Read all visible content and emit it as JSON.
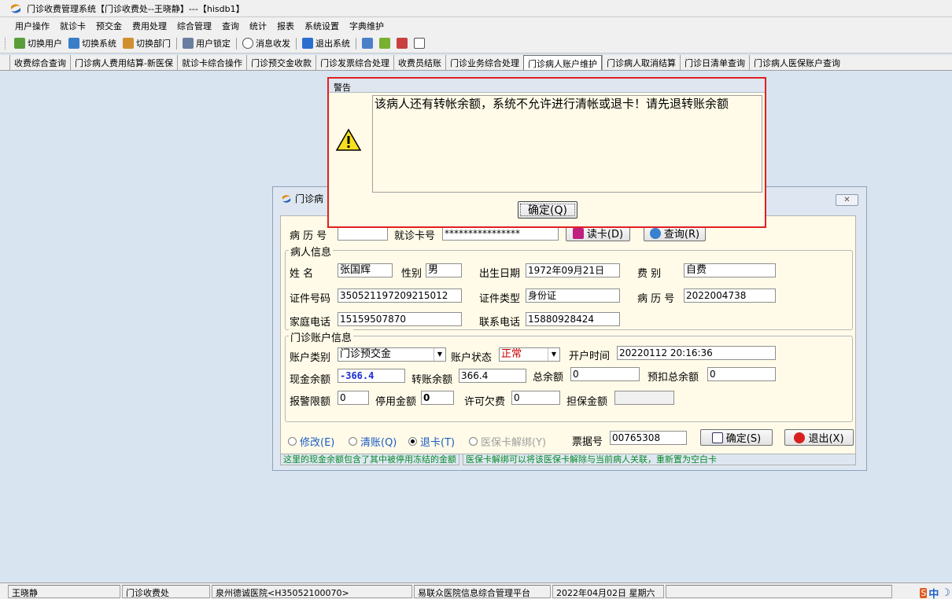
{
  "window": {
    "title": "门诊收费管理系统【门诊收费处--王晓静】---【hisdb1】"
  },
  "menu": [
    "用户操作",
    "就诊卡",
    "预交金",
    "费用处理",
    "综合管理",
    "查询",
    "统计",
    "报表",
    "系统设置",
    "字典维护"
  ],
  "toolbar": {
    "switch_user": "切换用户",
    "switch_system": "切换系统",
    "switch_dept": "切换部门",
    "lock_user": "用户锁定",
    "messages": "消息收发",
    "exit_system": "退出系统"
  },
  "tabs": [
    {
      "label": "收费综合查询",
      "active": false
    },
    {
      "label": "门诊病人费用结算-新医保",
      "active": false
    },
    {
      "label": "就诊卡综合操作",
      "active": false
    },
    {
      "label": "门诊预交金收款",
      "active": false
    },
    {
      "label": "门诊发票综合处理",
      "active": false
    },
    {
      "label": "收费员结账",
      "active": false
    },
    {
      "label": "门诊业务综合处理",
      "active": false
    },
    {
      "label": "门诊病人账户维护",
      "active": true
    },
    {
      "label": "门诊病人取消结算",
      "active": false
    },
    {
      "label": "门诊日清单查询",
      "active": false
    },
    {
      "label": "门诊病人医保账户查询",
      "active": false
    }
  ],
  "account_dialog": {
    "title": "门诊病",
    "record_no_label": "病 历 号",
    "record_no_value": "",
    "card_no_label": "就诊卡号",
    "card_no_value": "****************",
    "read_card_btn": "读卡(D)",
    "query_btn": "查询(R)",
    "patient_group": "病人信息",
    "name_label": "姓    名",
    "name_value": "张国辉",
    "gender_label": "性别",
    "gender_value": "男",
    "birth_label": "出生日期",
    "birth_value": "1972年09月21日",
    "fee_label": "费    别",
    "fee_value": "自费",
    "id_no_label": "证件号码",
    "id_no_value": "350521197209215012",
    "id_type_label": "证件类型",
    "id_type_value": "身份证",
    "record_no2_label": "病 历 号",
    "record_no2_value": "2022004738",
    "home_phone_label": "家庭电话",
    "home_phone_value": "15159507870",
    "contact_phone_label": "联系电话",
    "contact_phone_value": "15880928424",
    "account_group": "门诊账户信息",
    "acct_type_label": "账户类别",
    "acct_type_value": "门诊预交金",
    "acct_status_label": "账户状态",
    "acct_status_value": "正常",
    "open_time_label": "开户时间",
    "open_time_value": "20220112 20:16:36",
    "cash_balance_label": "现金余额",
    "cash_balance_value": "-366.4",
    "transfer_balance_label": "转账余额",
    "transfer_balance_value": "366.4",
    "total_balance_label": "总余额",
    "total_balance_value": "0",
    "prededuct_label": "预扣总余额",
    "prededuct_value": "0",
    "alarm_limit_label": "报警限额",
    "alarm_limit_value": "0",
    "stop_amount_label": "停用金额",
    "stop_amount_value": "0",
    "overdraft_label": "许可欠费",
    "overdraft_value": "0",
    "guarantee_label": "担保金额",
    "guarantee_value": "",
    "radio_modify": "修改(E)",
    "radio_clear": "清账(Q)",
    "radio_refund": "退卡(T)",
    "radio_unbind": "医保卡解绑(Y)",
    "receipt_label": "票据号",
    "receipt_value": "00765308",
    "confirm_btn": "确定(S)",
    "exit_btn": "退出(X)",
    "hint1": "这里的现金余额包含了其中被停用冻结的金额",
    "hint2": "医保卡解绑可以将该医保卡解除与当前病人关联，重新置为空白卡"
  },
  "warning": {
    "title": "警告",
    "message": "该病人还有转帐余额，系统不允许进行清帐或退卡！请先退转账余额",
    "ok": "确定(Q)"
  },
  "status": {
    "user": "王晓静",
    "dept": "门诊收费处",
    "hospital": "泉州德诚医院<H35052100070>",
    "platform": "易联众医院信息综合管理平台",
    "date": "2022年04月02日  星期六"
  },
  "ime": {
    "s": "S",
    "zh": "中"
  },
  "colors": {
    "accent_red": "#e02020",
    "hint_green": "#0a8a2a",
    "link_blue": "#1c5bc5"
  }
}
